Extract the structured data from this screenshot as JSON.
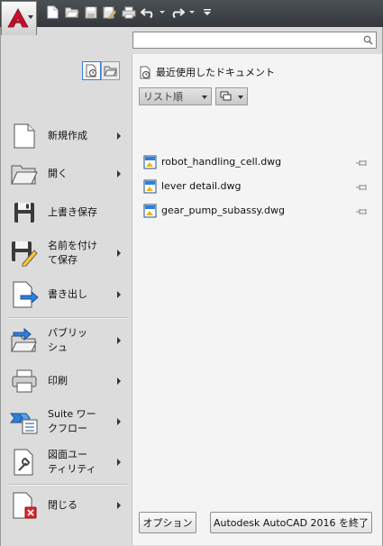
{
  "search": {
    "value": "",
    "placeholder": ""
  },
  "menu": {
    "items": [
      {
        "label": "新規作成",
        "has_submenu": true
      },
      {
        "label": "開く",
        "has_submenu": true
      },
      {
        "label": "上書き保存",
        "has_submenu": false
      },
      {
        "label": "名前を付け\nて保存",
        "has_submenu": true
      },
      {
        "label": "書き出し",
        "has_submenu": true
      },
      {
        "label": "パブリッ\nシュ",
        "has_submenu": true
      },
      {
        "label": "印刷",
        "has_submenu": true
      },
      {
        "label": "Suite ワー\nクフロー",
        "has_submenu": true
      },
      {
        "label": "図面ユー\nティリティ",
        "has_submenu": true
      },
      {
        "label": "閉じる",
        "has_submenu": true
      }
    ]
  },
  "recent": {
    "title": "最近使用したドキュメント",
    "sort_label": "リスト順",
    "files": [
      {
        "name": "robot_handling_cell.dwg"
      },
      {
        "name": "lever detail.dwg"
      },
      {
        "name": "gear_pump_subassy.dwg"
      }
    ]
  },
  "footer": {
    "options_label": "オプション",
    "exit_label": "Autodesk AutoCAD 2016 を終了"
  },
  "colors": {
    "accent": "#c8102e",
    "frame": "#dcdcdc",
    "pane": "#f4f4f4",
    "titlebar": "#3c4045"
  }
}
